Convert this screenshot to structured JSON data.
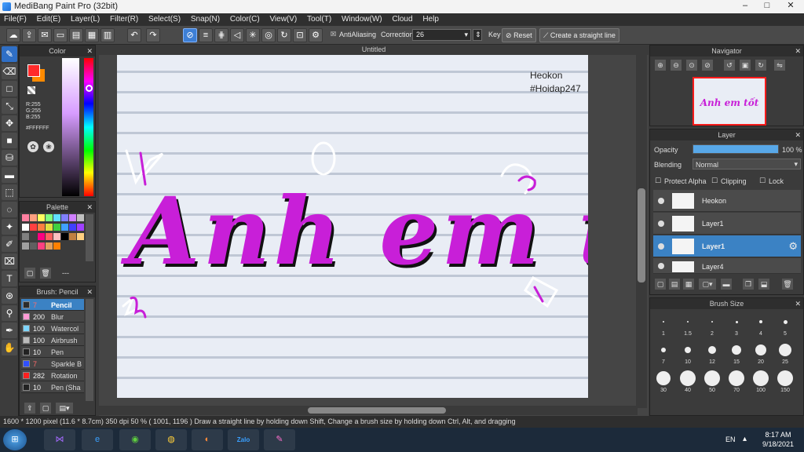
{
  "window": {
    "title": "MediBang Paint Pro (32bit)"
  },
  "menu": [
    "File(F)",
    "Edit(E)",
    "Layer(L)",
    "Filter(R)",
    "Select(S)",
    "Snap(N)",
    "Color(C)",
    "View(V)",
    "Tool(T)",
    "Window(W)",
    "Cloud",
    "Help"
  ],
  "toolbar": {
    "antialias_label": "AntiAliasing",
    "correction_label": "Correction",
    "correction_value": "26",
    "key_label": "Key",
    "reset_label": "Reset",
    "straight_label": "Create a straight line"
  },
  "color_panel": {
    "title": "Color",
    "r": "R:255",
    "g": "G:255",
    "b": "B:255",
    "hex": "#FFFFFF",
    "primary": "#ff2a2a",
    "secondary": "#ff8a00"
  },
  "palette_panel": {
    "title": "Palette",
    "swatches": [
      "#ff80a0",
      "#ffa080",
      "#ffff60",
      "#80ff80",
      "#60e0ff",
      "#8080ff",
      "#d080ff",
      "#c0c0c0",
      "#ffffff",
      "#ff4040",
      "#ff8040",
      "#e0e040",
      "#40d040",
      "#40a0ff",
      "#4040ff",
      "#a040ff",
      "#808080",
      "#404040",
      "#ff0080",
      "#ff6060",
      "#ffc0c0",
      "#000000",
      "#c08040",
      "#ffd080",
      "#a0a0a0",
      "#606060",
      "#ff4080",
      "#e0a060",
      "#ff8000"
    ],
    "dash": "---"
  },
  "brush_panel": {
    "title": "Brush: Pencil",
    "items": [
      {
        "size": "7",
        "name": "Pencil",
        "color": "#2b2b2b"
      },
      {
        "size": "200",
        "name": "Blur",
        "color": "#ff9ad5"
      },
      {
        "size": "100",
        "name": "Watercol",
        "color": "#7fd6ff"
      },
      {
        "size": "100",
        "name": "Airbrush",
        "color": "#bbbbbb"
      },
      {
        "size": "10",
        "name": "Pen",
        "color": "#222222"
      },
      {
        "size": "7",
        "name": "Sparkle B",
        "color": "#3050ff"
      },
      {
        "size": "282",
        "name": "Rotation",
        "color": "#ff2020"
      },
      {
        "size": "10",
        "name": "Pen (Sha",
        "color": "#222222"
      }
    ]
  },
  "canvas": {
    "tab": "Untitled",
    "sig1": "Heokon",
    "sig2": "#Hoidap247",
    "art_text": "Anh em tốt"
  },
  "navigator": {
    "title": "Navigator"
  },
  "layer_panel": {
    "title": "Layer",
    "opacity_label": "Opacity",
    "opacity_value": "100 %",
    "opacity_fraction": 1.0,
    "blending_label": "Blending",
    "blending_value": "Normal",
    "protect_label": "Protect Alpha",
    "clipping_label": "Clipping",
    "lock_label": "Lock",
    "layers": [
      {
        "name": "Heokon"
      },
      {
        "name": "Layer1"
      },
      {
        "name": "Layer1"
      },
      {
        "name": "Layer4"
      }
    ]
  },
  "brush_size": {
    "title": "Brush Size",
    "sizes": [
      "1",
      "1.5",
      "2",
      "3",
      "4",
      "5",
      "7",
      "10",
      "12",
      "15",
      "20",
      "25",
      "30",
      "40",
      "50",
      "70",
      "100",
      "150"
    ]
  },
  "status": {
    "text": "1600 * 1200 pixel   (11.6 * 8.7cm)   350 dpi   50 %   ( 1001, 1196 )   Draw a straight line by holding down Shift, Change a brush size by holding down Ctrl, Alt, and dragging"
  },
  "taskbar": {
    "lang": "EN",
    "time": "8:17 AM",
    "date": "9/18/2021",
    "zalo": "Zalo"
  },
  "colors": {
    "accent": "#3d7fd6",
    "art_magenta": "#c81fd8"
  }
}
